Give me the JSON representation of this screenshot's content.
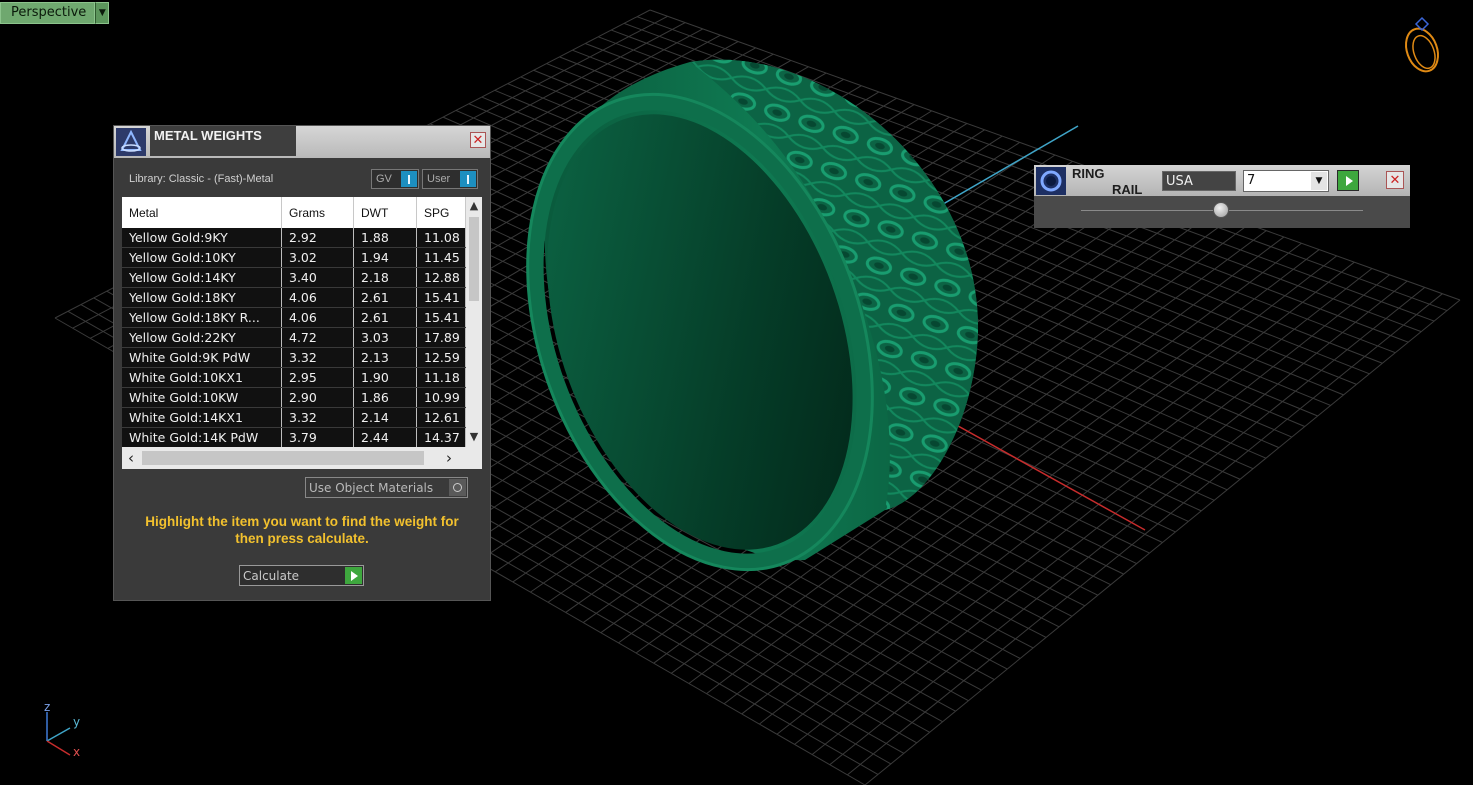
{
  "viewport": {
    "label": "Perspective",
    "axes": {
      "z": "z",
      "y": "y",
      "x": "x"
    }
  },
  "metal_weights": {
    "title": "METAL WEIGHTS",
    "library": "Library: Classic - (Fast)-Metal",
    "toggle_gv": "GV",
    "toggle_user": "User",
    "columns": [
      "Metal",
      "Grams",
      "DWT",
      "SPG"
    ],
    "rows": [
      [
        "Yellow Gold:9KY",
        "2.92",
        "1.88",
        "11.08"
      ],
      [
        "Yellow Gold:10KY",
        "3.02",
        "1.94",
        "11.45"
      ],
      [
        "Yellow Gold:14KY",
        "3.40",
        "2.18",
        "12.88"
      ],
      [
        "Yellow Gold:18KY",
        "4.06",
        "2.61",
        "15.41"
      ],
      [
        "Yellow Gold:18KY R...",
        "4.06",
        "2.61",
        "15.41"
      ],
      [
        "Yellow Gold:22KY",
        "4.72",
        "3.03",
        "17.89"
      ],
      [
        "White Gold:9K PdW",
        "3.32",
        "2.13",
        "12.59"
      ],
      [
        "White Gold:10KX1",
        "2.95",
        "1.90",
        "11.18"
      ],
      [
        "White Gold:10KW",
        "2.90",
        "1.86",
        "10.99"
      ],
      [
        "White Gold:14KX1",
        "3.32",
        "2.14",
        "12.61"
      ],
      [
        "White Gold:14K PdW",
        "3.79",
        "2.44",
        "14.37"
      ]
    ],
    "use_object_materials": "Use Object Materials",
    "hint": "Highlight the item you want to find the weight for then press calculate.",
    "calculate": "Calculate"
  },
  "ring_rail": {
    "title_line1": "RING",
    "title_line2": "RAIL",
    "standard": "USA",
    "size": "7"
  },
  "colors": {
    "ring": "#0e6b4a",
    "grid": "#3a3a3a",
    "accent_yellow": "#f2c12e",
    "play_green": "#3ea73e"
  }
}
